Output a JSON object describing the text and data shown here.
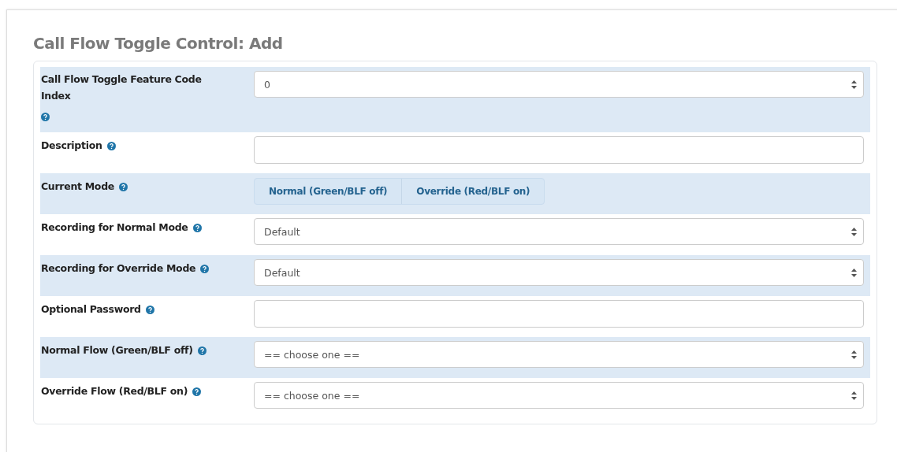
{
  "title": "Call Flow Toggle Control: Add",
  "fields": [
    {
      "label": "Call Flow Toggle Feature Code Index",
      "kind": "select",
      "value": "0"
    },
    {
      "label": "Description",
      "kind": "text"
    },
    {
      "label": "Current Mode",
      "kind": "toggle",
      "options": [
        {
          "label": "Normal (Green/BLF off)",
          "selected": false
        },
        {
          "label": "Override (Red/BLF on)",
          "selected": false
        }
      ]
    },
    {
      "label": "Recording for Normal Mode",
      "kind": "select",
      "value": "Default"
    },
    {
      "label": "Recording for Override Mode",
      "kind": "select",
      "value": "Default"
    },
    {
      "label": "Optional Password",
      "kind": "text"
    },
    {
      "label": "Normal Flow (Green/BLF off)",
      "kind": "select",
      "value": "== choose one =="
    },
    {
      "label": "Override Flow (Red/BLF on)",
      "kind": "select",
      "value": "== choose one =="
    }
  ]
}
